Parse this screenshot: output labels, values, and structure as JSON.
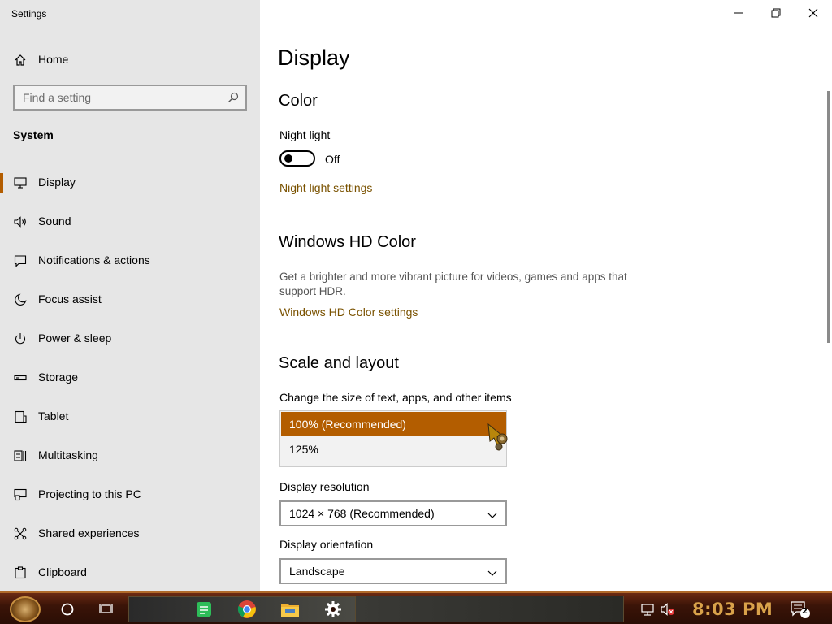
{
  "window": {
    "app_title": "Settings",
    "controls": {
      "minimize_icon": "minimize-icon",
      "maximize_icon": "restore-icon",
      "close_icon": "close-icon"
    }
  },
  "sidebar": {
    "home_label": "Home",
    "search_placeholder": "Find a setting",
    "section_title": "System",
    "items": [
      {
        "label": "Display",
        "icon": "monitor-icon",
        "active": true
      },
      {
        "label": "Sound",
        "icon": "speaker-icon"
      },
      {
        "label": "Notifications & actions",
        "icon": "notification-icon"
      },
      {
        "label": "Focus assist",
        "icon": "moon-icon"
      },
      {
        "label": "Power & sleep",
        "icon": "power-icon"
      },
      {
        "label": "Storage",
        "icon": "storage-icon"
      },
      {
        "label": "Tablet",
        "icon": "tablet-icon"
      },
      {
        "label": "Multitasking",
        "icon": "multitasking-icon"
      },
      {
        "label": "Projecting to this PC",
        "icon": "projecting-icon"
      },
      {
        "label": "Shared experiences",
        "icon": "shared-icon"
      },
      {
        "label": "Clipboard",
        "icon": "clipboard-icon"
      }
    ]
  },
  "main": {
    "page_title": "Display",
    "color": {
      "heading": "Color",
      "night_light_label": "Night light",
      "night_light_state": "Off",
      "night_light_link": "Night light settings"
    },
    "hdr": {
      "heading": "Windows HD Color",
      "description": "Get a brighter and more vibrant picture for videos, games and apps that support HDR.",
      "link": "Windows HD Color settings"
    },
    "scale": {
      "heading": "Scale and layout",
      "change_size_label": "Change the size of text, apps, and other items",
      "options": [
        "100% (Recommended)",
        "125%"
      ],
      "selected": "100% (Recommended)",
      "resolution_label": "Display resolution",
      "resolution_value": "1024 × 768 (Recommended)",
      "orientation_label": "Display orientation",
      "orientation_value": "Landscape"
    }
  },
  "taskbar": {
    "clock": "8:03 PM",
    "notification_count": "2",
    "accent": "#d9a24a"
  },
  "colors": {
    "accent": "#b35d00",
    "link": "#7a5200",
    "sidebar_bg": "#e6e6e6"
  }
}
